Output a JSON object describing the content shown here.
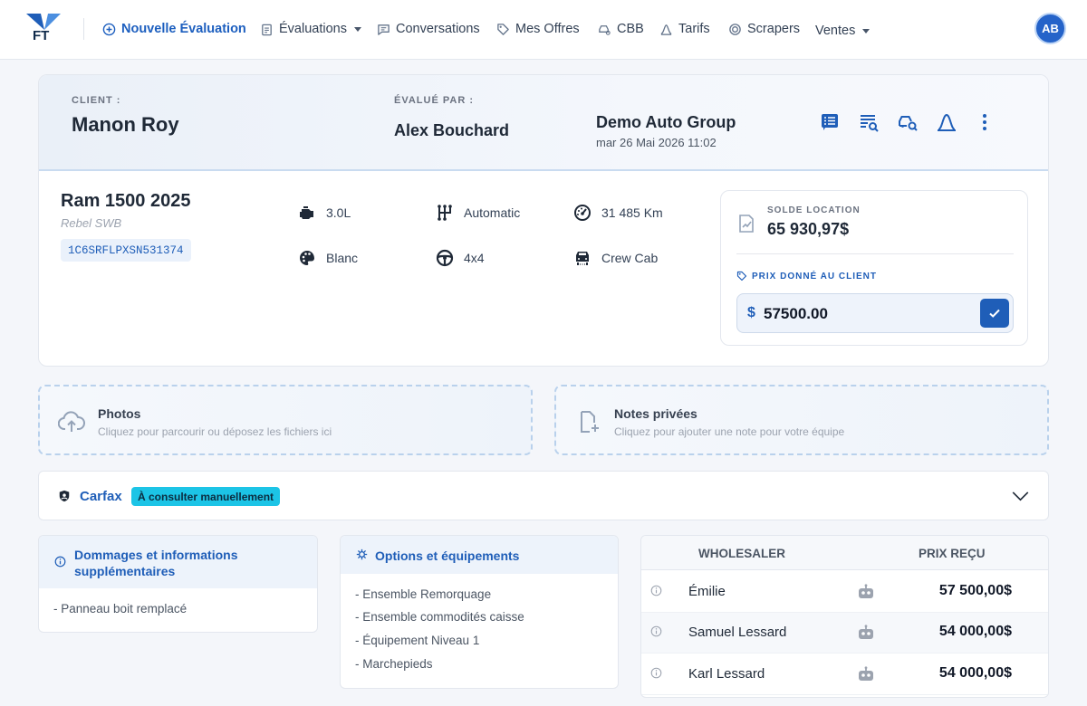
{
  "nav": {
    "logo_text": "FT",
    "new_eval": "Nouvelle Évaluation",
    "evaluations": "Évaluations",
    "conversations": "Conversations",
    "offers": "Mes Offres",
    "cbb": "CBB",
    "tarifs": "Tarifs",
    "scrapers": "Scrapers",
    "ventes": "Ventes",
    "avatar": "AB"
  },
  "header": {
    "client_label": "CLIENT :",
    "client_name": "Manon Roy",
    "evaluated_label": "ÉVALUÉ PAR :",
    "evaluator": "Alex Bouchard",
    "dealer": "Demo Auto Group",
    "date": "mar 26 Mai 2026 11:02"
  },
  "vehicle": {
    "title": "Ram 1500 2025",
    "trim": "Rebel SWB",
    "vin": "1C6SRFLPXSN531374",
    "engine": "3.0L",
    "transmission": "Automatic",
    "mileage": "31 485 Km",
    "color": "Blanc",
    "drivetrain": "4x4",
    "cab": "Crew Cab"
  },
  "lease": {
    "label": "SOLDE LOCATION",
    "value": "65 930,97$",
    "price_label": "PRIX DONNÉ AU CLIENT",
    "currency": "$",
    "price_value": "57500.00"
  },
  "uploads": {
    "photos_title": "Photos",
    "photos_sub": "Cliquez pour parcourir ou déposez les fichiers ici",
    "notes_title": "Notes privées",
    "notes_sub": "Cliquez pour ajouter une note pour votre équipe"
  },
  "carfax": {
    "title": "Carfax",
    "badge": "À consulter manuellement"
  },
  "damages": {
    "title_line1": "Dommages et informations",
    "title_line2": "supplémentaires",
    "items": [
      "- Panneau boit remplacé"
    ]
  },
  "options": {
    "title": "Options et équipements",
    "items": [
      "- Ensemble Remorquage",
      "- Ensemble commodités caisse",
      "- Équipement Niveau 1",
      "- Marchepieds"
    ]
  },
  "wholesalers": {
    "col_name": "WHOLESALER",
    "col_price": "PRIX REÇU",
    "rows": [
      {
        "name": "Émilie",
        "price": "57 500,00$"
      },
      {
        "name": "Samuel Lessard",
        "price": "54 000,00$"
      },
      {
        "name": "Karl Lessard",
        "price": "54 000,00$"
      }
    ]
  },
  "colors": {
    "accent": "#1f5eb8",
    "badge": "#1cc4e6"
  }
}
